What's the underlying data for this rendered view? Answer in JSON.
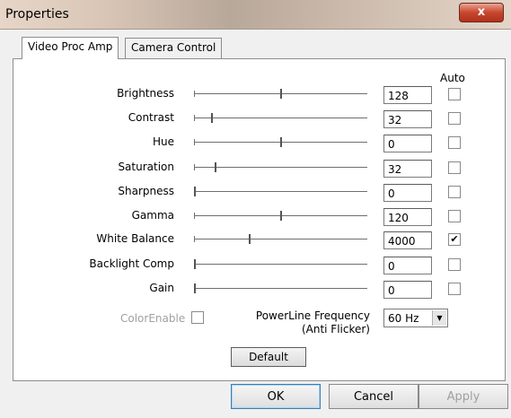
{
  "window": {
    "title": "Properties",
    "close_glyph": "x"
  },
  "tabs": [
    {
      "label": "Video Proc Amp",
      "active": true
    },
    {
      "label": "Camera Control",
      "active": false
    }
  ],
  "auto_header": "Auto",
  "rows": [
    {
      "label": "Brightness",
      "value": "128",
      "slider_fraction": 0.5,
      "auto_checked": false
    },
    {
      "label": "Contrast",
      "value": "32",
      "slider_fraction": 0.1,
      "auto_checked": false
    },
    {
      "label": "Hue",
      "value": "0",
      "slider_fraction": 0.5,
      "auto_checked": false
    },
    {
      "label": "Saturation",
      "value": "32",
      "slider_fraction": 0.12,
      "auto_checked": false
    },
    {
      "label": "Sharpness",
      "value": "0",
      "slider_fraction": 0.0,
      "auto_checked": false
    },
    {
      "label": "Gamma",
      "value": "120",
      "slider_fraction": 0.5,
      "auto_checked": false
    },
    {
      "label": "White Balance",
      "value": "4000",
      "slider_fraction": 0.32,
      "auto_checked": true
    },
    {
      "label": "Backlight Comp",
      "value": "0",
      "slider_fraction": 0.0,
      "auto_checked": false
    },
    {
      "label": "Gain",
      "value": "0",
      "slider_fraction": 0.0,
      "auto_checked": false
    }
  ],
  "color_enable": {
    "label": "ColorEnable",
    "checked": false,
    "disabled": true
  },
  "powerline": {
    "label_line1": "PowerLine Frequency",
    "label_line2": "(Anti Flicker)",
    "selected": "60 Hz"
  },
  "buttons": {
    "default": "Default",
    "ok": "OK",
    "cancel": "Cancel",
    "apply": "Apply"
  },
  "icons": {
    "close": "close-icon",
    "dropdown": "chevron-down-icon",
    "check": "checkmark-icon"
  }
}
